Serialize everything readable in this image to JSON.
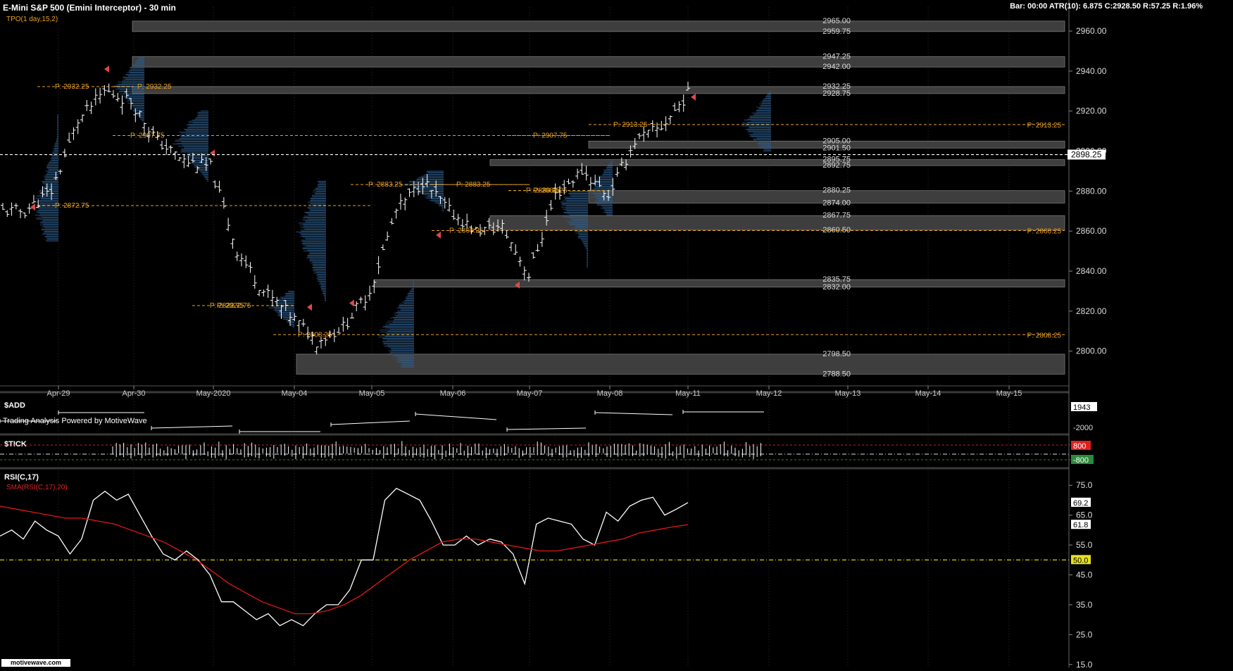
{
  "header": {
    "title": "E-Mini S&P 500 (Emini Interceptor) - 30 min",
    "tpo": "TPO(1 day,15,2)",
    "bar_info": "Bar: 00:00  ATR(10): 6.875  C:2928.50  R:57.25  R:1.96%"
  },
  "footer": {
    "powered": "Trading Analysis Powered by MotiveWave",
    "logo": "motivewave.com"
  },
  "colors": {
    "background": "#000000",
    "price_bar": "#ffffff",
    "tpo_profile": "#2f5f8f",
    "gap_zone": "#3e3e3e",
    "poc_line": "#e8a020",
    "current_price_line": "#ffffff",
    "sma_line": "#e01818",
    "marker": "#e04848",
    "tick_upper": "#c02020",
    "tick_lower": "#2a8a3a",
    "rsi_midline": "#d4d400"
  },
  "chart_data": [
    {
      "panel": "price",
      "type": "line",
      "title": "E-Mini S&P 500 (Emini Interceptor) - 30 min",
      "x_ticks": [
        "Apr-29",
        "Apr-30",
        "May-2020",
        "May-04",
        "May-05",
        "May-06",
        "May-07",
        "May-08",
        "May-11",
        "May-12",
        "May-13",
        "May-14",
        "May-15"
      ],
      "y_ticks": [
        2800,
        2820,
        2840,
        2860,
        2880,
        2900,
        2920,
        2940,
        2960
      ],
      "y_tick_labels": [
        "2800.00",
        "2820.00",
        "2840.00",
        "2860.00",
        "2880.00",
        "2900.00",
        "2920.00",
        "2940.00",
        "2960.00"
      ],
      "ylim": [
        2783,
        2972
      ],
      "current_price": 2898.25,
      "current_price_label": "2898.25",
      "gap_zones": [
        {
          "top": 2965.0,
          "bottom": 2959.75,
          "top_label": "2965.00",
          "bottom_label": "2959.75",
          "x_start": "Apr-30"
        },
        {
          "top": 2947.25,
          "bottom": 2942.0,
          "top_label": "2947.25",
          "bottom_label": "2942.00",
          "x_start": "Apr-30"
        },
        {
          "top": 2932.25,
          "bottom": 2928.75,
          "top_label": "2932.25",
          "bottom_label": "2928.75",
          "x_start": "Apr-30"
        },
        {
          "top": 2905.0,
          "bottom": 2901.5,
          "top_label": "2905.00",
          "bottom_label": "2901.50",
          "x_start": "May-08"
        },
        {
          "top": 2895.75,
          "bottom": 2892.75,
          "top_label": "2895.75",
          "bottom_label": "2892.75",
          "x_start": "May-07"
        },
        {
          "top": 2880.25,
          "bottom": 2874.0,
          "top_label": "2880.25",
          "bottom_label": "2874.00",
          "x_start": "May-08"
        },
        {
          "top": 2867.75,
          "bottom": 2860.5,
          "top_label": "2867.75",
          "bottom_label": "2860.50",
          "x_start": "May-07"
        },
        {
          "top": 2835.75,
          "bottom": 2832.0,
          "top_label": "2835.75",
          "bottom_label": "2832.00",
          "x_start": "May-05"
        },
        {
          "top": 2798.5,
          "bottom": 2788.5,
          "top_label": "2798.50",
          "bottom_label": "2788.50",
          "x_start": "May-04"
        }
      ],
      "poc_levels": [
        {
          "price": 2932.25,
          "label": "P: 2932.25",
          "x_start": "Apr-29",
          "x_end": "Apr-30",
          "extend": false
        },
        {
          "price": 2932.25,
          "label": "P: 2932.25",
          "x_start": "Apr-30",
          "x_end": "Apr-30",
          "extend": false
        },
        {
          "price": 2907.75,
          "label": "P: 2907.75",
          "x_start": "Apr-30",
          "x_end": "May-08",
          "extend": false
        },
        {
          "price": 2907.75,
          "label": "P: 2907.75",
          "x_start": "May-07",
          "x_end": "May-08",
          "extend": false
        },
        {
          "price": 2872.75,
          "label": "P: 2872.75",
          "x_start": "Apr-29",
          "x_end": "May-05",
          "extend": false
        },
        {
          "price": 2822.75,
          "label": "P: 2822.75",
          "x_start": "May-2020",
          "x_end": "May-04",
          "extend": false
        },
        {
          "price": 2822.75,
          "label": "P: 2822.75",
          "x_start": "May-2020",
          "x_end": "May-04",
          "extend": false
        },
        {
          "price": 2808.25,
          "label": "P: 2808.25",
          "x_start": "May-04",
          "x_end": "May-15",
          "extend": true
        },
        {
          "price": 2883.25,
          "label": "P: 2883.25",
          "x_start": "May-05",
          "x_end": "May-07",
          "extend": false
        },
        {
          "price": 2883.25,
          "label": "P: 2883.25",
          "x_start": "May-06",
          "x_end": "May-07",
          "extend": false
        },
        {
          "price": 2880.25,
          "label": "P: 2880.25",
          "x_start": "May-07",
          "x_end": "May-08",
          "extend": false
        },
        {
          "price": 2880.25,
          "label": "P: 2880.25",
          "x_start": "May-07",
          "x_end": "May-08",
          "extend": false
        },
        {
          "price": 2860.25,
          "label": "P: 2860.25",
          "x_start": "May-06",
          "x_end": "May-15",
          "extend": true
        },
        {
          "price": 2913.25,
          "label": "P: 2913.25",
          "x_start": "May-08",
          "x_end": "May-15",
          "extend": true
        }
      ],
      "closes": [
        {
          "x": "Apr-29",
          "y": 2870
        },
        {
          "x": "Apr-29",
          "y": 2880
        },
        {
          "x": "Apr-29",
          "y": 2915
        },
        {
          "x": "Apr-29",
          "y": 2930
        },
        {
          "x": "Apr-30",
          "y": 2925
        },
        {
          "x": "Apr-30",
          "y": 2905
        },
        {
          "x": "Apr-30",
          "y": 2895
        },
        {
          "x": "May-2020",
          "y": 2892
        },
        {
          "x": "May-2020",
          "y": 2850
        },
        {
          "x": "May-2020",
          "y": 2830
        },
        {
          "x": "May-04",
          "y": 2818
        },
        {
          "x": "May-04",
          "y": 2805
        },
        {
          "x": "May-04",
          "y": 2812
        },
        {
          "x": "May-05",
          "y": 2830
        },
        {
          "x": "May-05",
          "y": 2870
        },
        {
          "x": "May-05",
          "y": 2885
        },
        {
          "x": "May-06",
          "y": 2870
        },
        {
          "x": "May-06",
          "y": 2860
        },
        {
          "x": "May-06",
          "y": 2862
        },
        {
          "x": "May-07",
          "y": 2838
        },
        {
          "x": "May-07",
          "y": 2878
        },
        {
          "x": "May-07",
          "y": 2890
        },
        {
          "x": "May-08",
          "y": 2878
        },
        {
          "x": "May-08",
          "y": 2905
        },
        {
          "x": "May-08",
          "y": 2912
        },
        {
          "x": "May-11",
          "y": 2928.5
        }
      ]
    },
    {
      "panel": "$ADD",
      "type": "line",
      "title": "$ADD",
      "value_label": "1943",
      "y_tick_labels": [
        "-2000"
      ]
    },
    {
      "panel": "$TICK",
      "type": "bar",
      "title": "$TICK",
      "upper_label": "800",
      "lower_label": "-800"
    },
    {
      "panel": "RSI",
      "type": "line",
      "title": "RSI(C,17)",
      "sma_label": "SMA(RSI(C,17),20)",
      "y_ticks": [
        15,
        25,
        35,
        45,
        55,
        65,
        75
      ],
      "y_tick_labels": [
        "15.0",
        "25.0",
        "35.0",
        "45.0",
        "55.0",
        "65.0",
        "75.0"
      ],
      "ylim": [
        14,
        80
      ],
      "midline": 50,
      "labels": {
        "rsi": "69.2",
        "sma": "61.8",
        "mid": "50.0"
      },
      "series": [
        {
          "name": "RSI(C,17)",
          "values": [
            58,
            60,
            57,
            63,
            60,
            58,
            52,
            57,
            70,
            73,
            70,
            72,
            65,
            58,
            52,
            50,
            53,
            50,
            45,
            36,
            36,
            33,
            30,
            32,
            28,
            30,
            28,
            32,
            35,
            35,
            40,
            50,
            50,
            70,
            74,
            72,
            70,
            63,
            55,
            55,
            58,
            55,
            57,
            56,
            52,
            42,
            62,
            64,
            63,
            62,
            57,
            55,
            66,
            63,
            68,
            70,
            71,
            65,
            67,
            69.2
          ]
        },
        {
          "name": "SMA(RSI(C,17),20)",
          "values": [
            68,
            67,
            66,
            65,
            64,
            64,
            63,
            62,
            60,
            58,
            56,
            53,
            50,
            46,
            42,
            39,
            36,
            34,
            32,
            32,
            33,
            35,
            38,
            42,
            46,
            50,
            53,
            56,
            57,
            57,
            56,
            55,
            54,
            53,
            53,
            54,
            55,
            56,
            57,
            59,
            60,
            61,
            61.8
          ]
        }
      ]
    }
  ]
}
